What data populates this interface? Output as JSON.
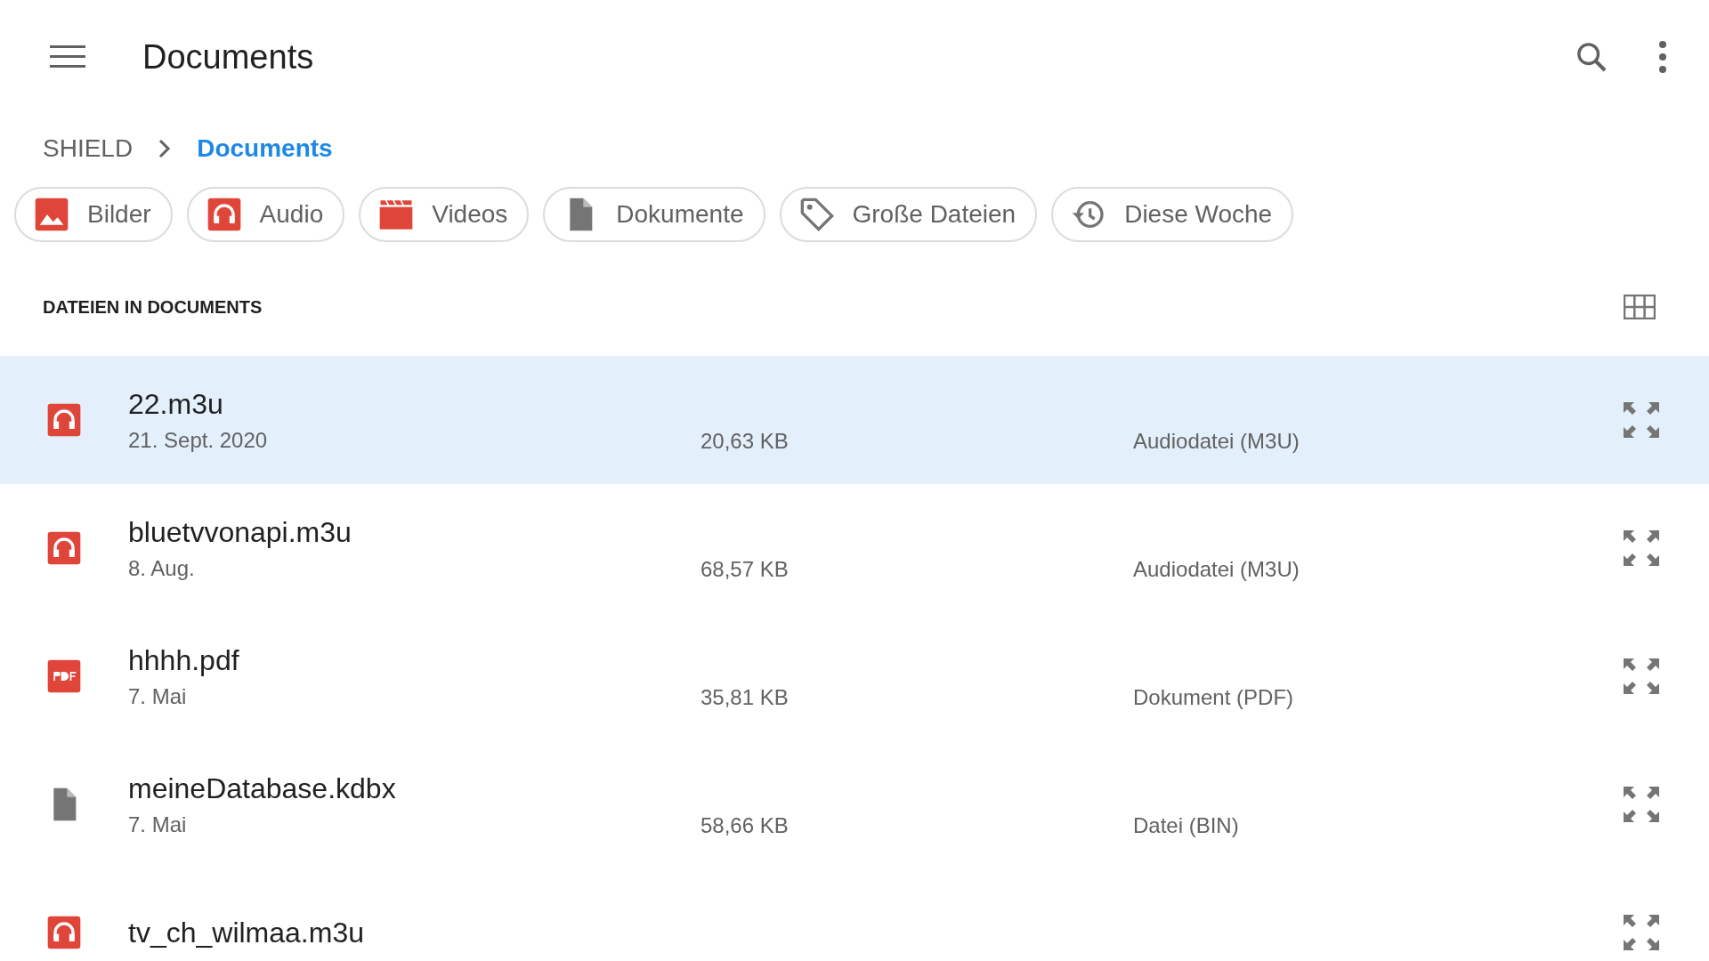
{
  "app_bar": {
    "title": "Documents"
  },
  "breadcrumb": [
    {
      "label": "SHIELD",
      "selected": false
    },
    {
      "label": "Documents",
      "selected": true
    }
  ],
  "chips": [
    {
      "label": "Bilder",
      "kind": "image"
    },
    {
      "label": "Audio",
      "kind": "audio"
    },
    {
      "label": "Videos",
      "kind": "video"
    },
    {
      "label": "Dokumente",
      "kind": "document"
    },
    {
      "label": "Große Dateien",
      "kind": "tag"
    },
    {
      "label": "Diese Woche",
      "kind": "history"
    }
  ],
  "section": {
    "title": "DATEIEN IN DOCUMENTS"
  },
  "files": [
    {
      "name": "22.m3u",
      "date": "21. Sept. 2020",
      "size": "20,63 KB",
      "type": "Audiodatei (M3U)",
      "kind": "audio",
      "selected": true
    },
    {
      "name": "bluetvvonapi.m3u",
      "date": "8. Aug.",
      "size": "68,57 KB",
      "type": "Audiodatei (M3U)",
      "kind": "audio",
      "selected": false
    },
    {
      "name": "hhhh.pdf",
      "date": "7. Mai",
      "size": "35,81 KB",
      "type": "Dokument (PDF)",
      "kind": "pdf",
      "selected": false
    },
    {
      "name": "meineDatabase.kdbx",
      "date": "7. Mai",
      "size": "58,66 KB",
      "type": "Datei (BIN)",
      "kind": "file",
      "selected": false
    },
    {
      "name": "tv_ch_wilmaa.m3u",
      "kind": "audio",
      "selected": false
    }
  ]
}
